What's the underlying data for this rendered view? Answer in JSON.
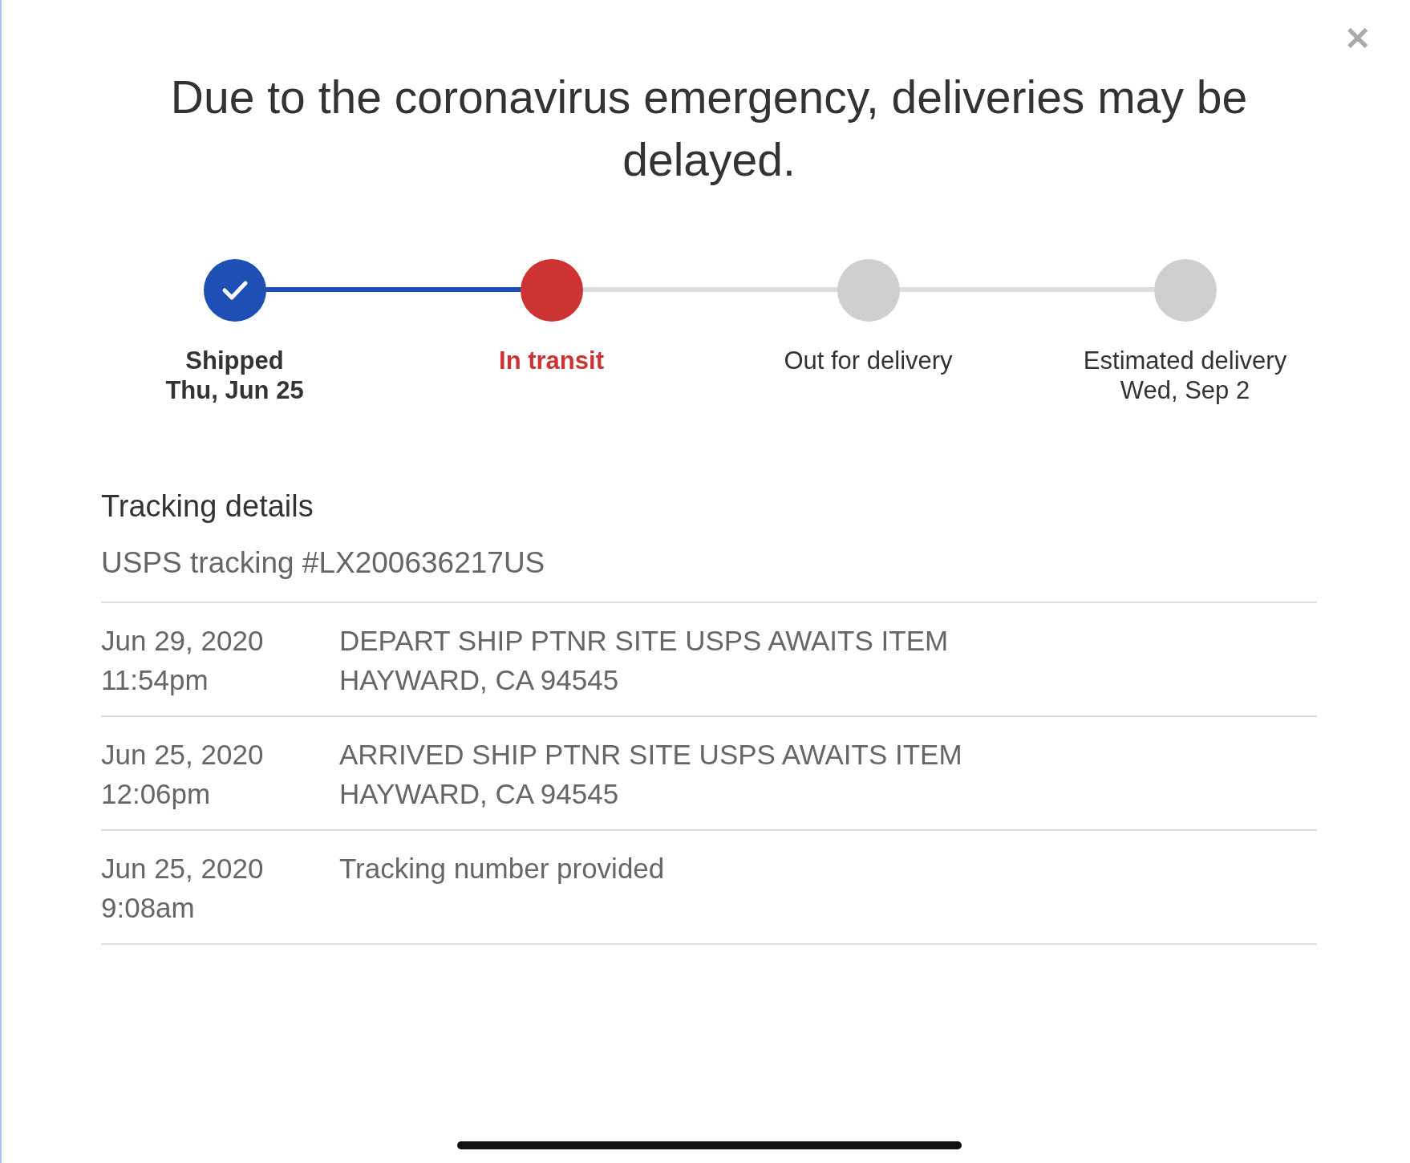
{
  "notice": "Due to the coronavirus emergency, deliveries may be delayed.",
  "close": {
    "label": "✕"
  },
  "steps": [
    {
      "label": "Shipped",
      "sublabel": "Thu, Jun 25",
      "completed": true,
      "current": false
    },
    {
      "label": "In transit",
      "completed": false,
      "current": true
    },
    {
      "label": "Out for delivery",
      "completed": false,
      "current": false
    },
    {
      "label": "Estimated delivery",
      "sublabel": "Wed, Sep 2",
      "completed": false,
      "current": false
    }
  ],
  "tracking": {
    "heading": "Tracking details",
    "number": "USPS tracking #LX200636217US"
  },
  "events": [
    {
      "date": "Jun 29, 2020",
      "time": "11:54pm",
      "description": "DEPART SHIP PTNR SITE USPS AWAITS ITEM",
      "location": "HAYWARD, CA 94545"
    },
    {
      "date": "Jun 25, 2020",
      "time": "12:06pm",
      "description": "ARRIVED SHIP PTNR SITE USPS AWAITS ITEM",
      "location": "HAYWARD, CA 94545"
    },
    {
      "date": "Jun 25, 2020",
      "time": "9:08am",
      "description": "Tracking number provided"
    }
  ]
}
